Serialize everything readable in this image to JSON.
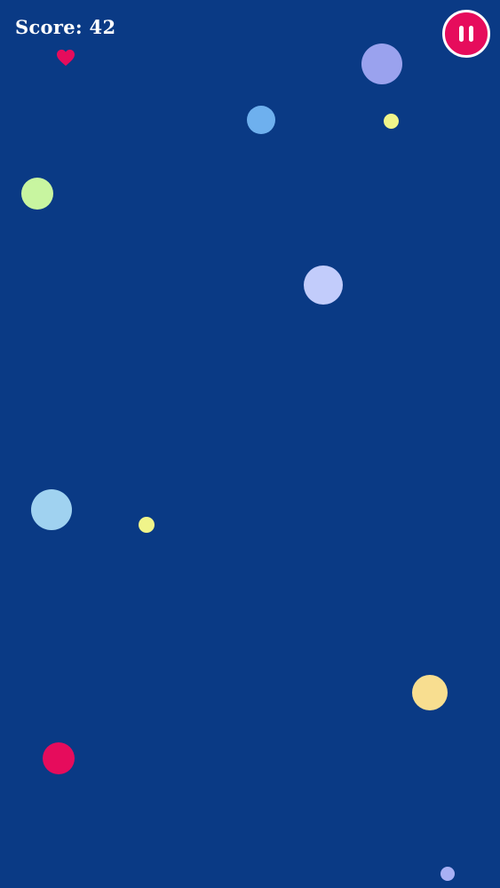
{
  "hud": {
    "score_text": "Score: 42",
    "lives": 1,
    "heart_color": "#e60c5c",
    "pause_button_color": "#e60c5c",
    "pause_icon": "pause-icon"
  },
  "playfield": {
    "background_color": "#0a3a85",
    "bubbles": [
      {
        "name": "bubble-violet",
        "color": "#9aa2ee"
      },
      {
        "name": "bubble-sky-blue",
        "color": "#6eb0ee"
      },
      {
        "name": "bubble-small-yellow",
        "color": "#f0f48a"
      },
      {
        "name": "bubble-green",
        "color": "#c8f5a0"
      },
      {
        "name": "bubble-lavender",
        "color": "#c2ccfb"
      },
      {
        "name": "bubble-light-blue",
        "color": "#a0d2f0"
      },
      {
        "name": "bubble-small-yellow",
        "color": "#f0f48a"
      },
      {
        "name": "bubble-peach",
        "color": "#f8de90"
      },
      {
        "name": "bubble-red",
        "color": "#e60c5c"
      },
      {
        "name": "bubble-small-periwinkle",
        "color": "#a8b0f4"
      }
    ]
  }
}
